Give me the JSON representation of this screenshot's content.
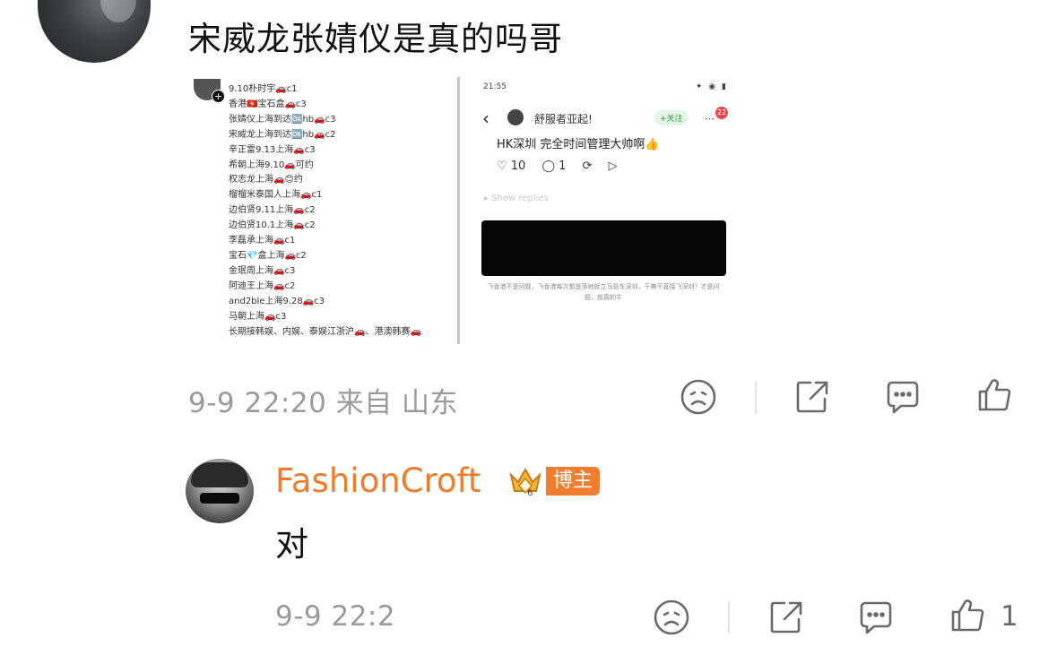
{
  "comment": {
    "text": "宋威龙张婧仪是真的吗哥",
    "meta": "9-9 22:20 来自 山东"
  },
  "left_image": {
    "lines": [
      "9.10朴时宇🚗c1",
      "香港🇭🇰宝石盒🚗c3",
      "张婧仪上海到达🆗hb🚗c3",
      "宋威龙上海到达🆗hb🚗c2",
      "辛正雷9.13上海🚗c3",
      "希朝上海9.10🚗可约",
      "权志龙上海🚗😊约",
      "榴榴米泰国人上海🚗c1",
      "边伯贤9.11上海🚗c2",
      "边伯贤10.1上海🚗c2",
      "李磊承上海🚗c1",
      "宝石💎盒上海🚗c2",
      "金珉周上海🚗c3",
      "阿迪王上海🚗c2",
      "and2ble上海9.28🚗c3",
      "马朝上海🚗c3",
      "长期接韩娱、内娱、泰娱江浙沪🚗、港澳韩赛🚗"
    ]
  },
  "right_image": {
    "status_time": "21:55",
    "status_right": "✦ ◉ ▮",
    "back": "‹",
    "name": "舒服者亚起!",
    "follow": "+关注",
    "more": "⋯",
    "notif": "22",
    "title": "HK深圳 完全时间管理大帅啊👍",
    "likes": "♡ 10",
    "comments": "◯ 1",
    "share": "⟳",
    "send": "▷",
    "faint": "▸ Show replies",
    "caption": "飞香港不是问题，飞香港每次都是落地就立马驱车深圳，干嘛不直接飞深圳？才是问题，就真的牛"
  },
  "reply": {
    "username": "FashionCroft",
    "role_badge": "博主",
    "text": "对",
    "meta": "9-9 22:2",
    "like_count": "1"
  },
  "colors": {
    "username": "#f07b2a",
    "badge": "#f07e2e",
    "meta_gray": "#9a9a9a",
    "icon_gray": "#6a6a6a"
  },
  "icons": [
    "sad-face-icon",
    "share-icon",
    "comment-icon",
    "thumbs-up-icon"
  ]
}
